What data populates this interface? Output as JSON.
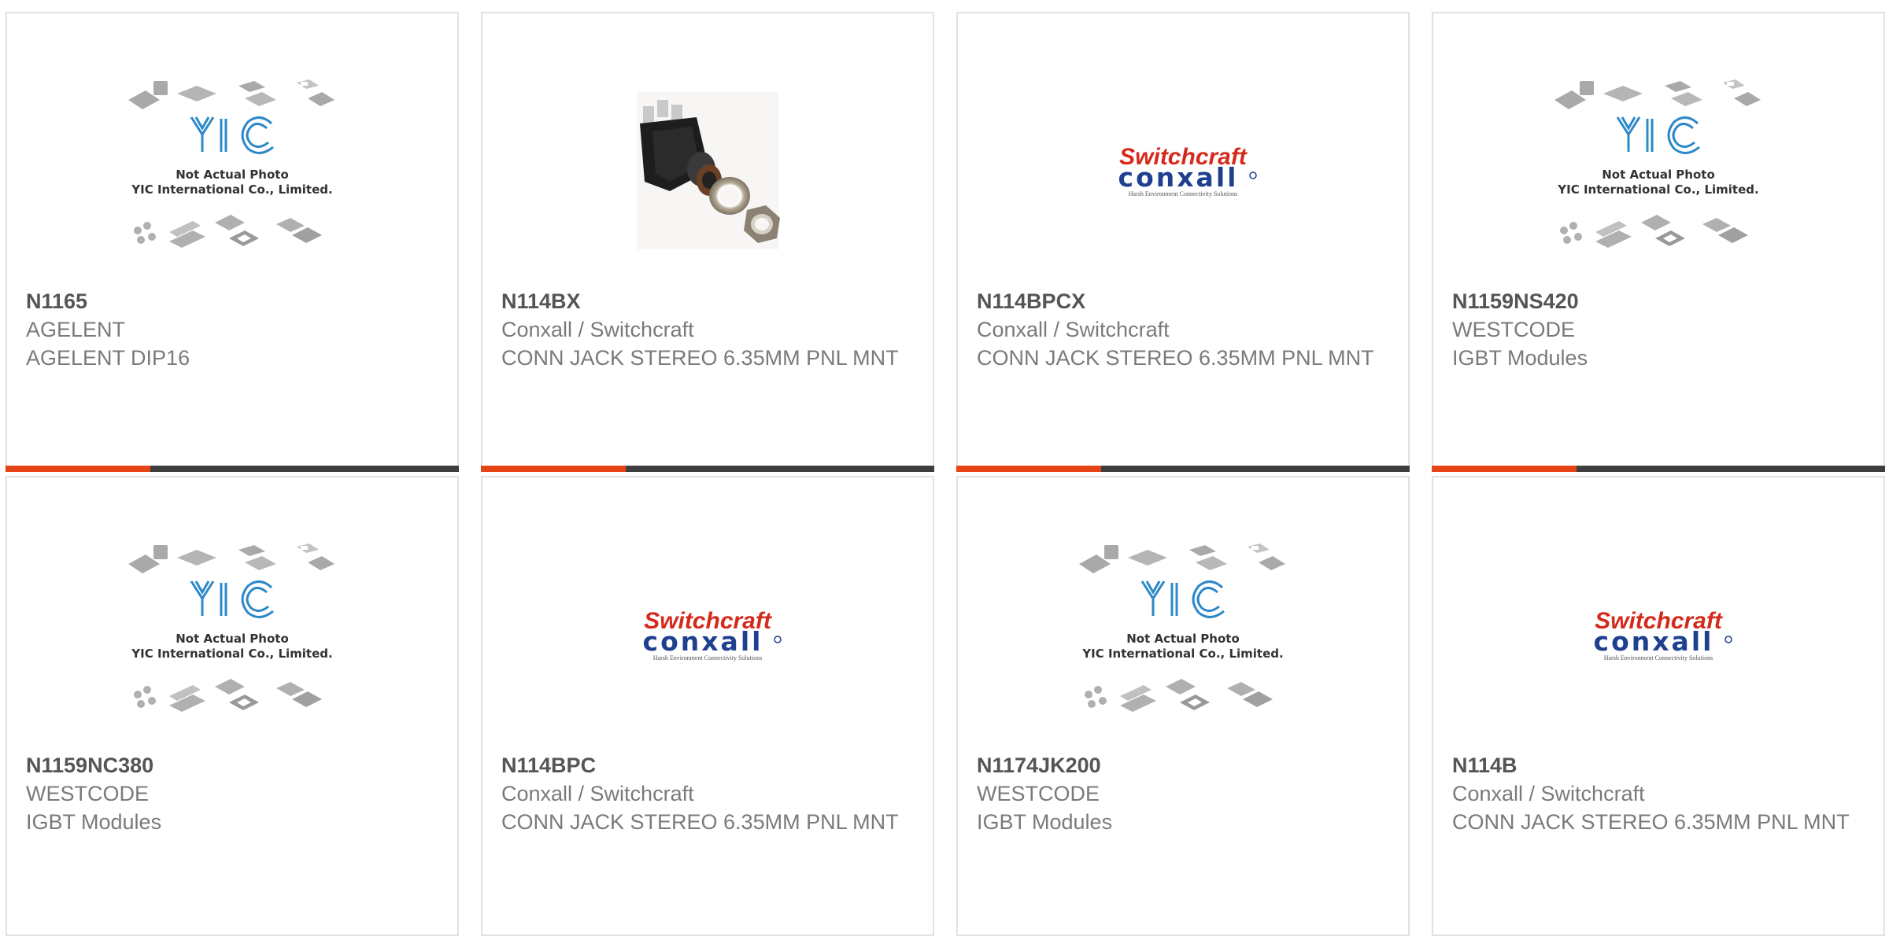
{
  "colors": {
    "accent": "#e64316",
    "bar": "#3e3e3e",
    "yic_blue": "#2c88c8",
    "switchcraft_red": "#d42a1c",
    "conxall_blue": "#1f3f8f"
  },
  "products": [
    {
      "part": "N1165",
      "maker": "AGELENT",
      "desc": "AGELENT DIP16",
      "image": "yic-placeholder",
      "placeholder": {
        "line1": "Not Actual Photo",
        "line2": "YIC International Co., Limited."
      }
    },
    {
      "part": "N114BX",
      "maker": "Conxall / Switchcraft",
      "desc": "CONN JACK STEREO 6.35MM PNL MNT",
      "image": "jack-photo"
    },
    {
      "part": "N114BPCX",
      "maker": "Conxall / Switchcraft",
      "desc": "CONN JACK STEREO 6.35MM PNL MNT",
      "image": "switchcraft-logo",
      "logo": {
        "top": "Switchcraft",
        "bottom": "conxall",
        "tagline": "Harsh Environment Connectivity Solutions"
      }
    },
    {
      "part": "N1159NS420",
      "maker": "WESTCODE",
      "desc": "IGBT Modules",
      "image": "yic-placeholder",
      "placeholder": {
        "line1": "Not Actual Photo",
        "line2": "YIC International Co., Limited."
      }
    },
    {
      "part": "N1159NC380",
      "maker": "WESTCODE",
      "desc": "IGBT Modules",
      "image": "yic-placeholder",
      "placeholder": {
        "line1": "Not Actual Photo",
        "line2": "YIC International Co., Limited."
      }
    },
    {
      "part": "N114BPC",
      "maker": "Conxall / Switchcraft",
      "desc": "CONN JACK STEREO 6.35MM PNL MNT",
      "image": "switchcraft-logo",
      "logo": {
        "top": "Switchcraft",
        "bottom": "conxall",
        "tagline": "Harsh Environment Connectivity Solutions"
      }
    },
    {
      "part": "N1174JK200",
      "maker": "WESTCODE",
      "desc": "IGBT Modules",
      "image": "yic-placeholder",
      "placeholder": {
        "line1": "Not Actual Photo",
        "line2": "YIC International Co., Limited."
      }
    },
    {
      "part": "N114B",
      "maker": "Conxall / Switchcraft",
      "desc": "CONN JACK STEREO 6.35MM PNL MNT",
      "image": "switchcraft-logo",
      "logo": {
        "top": "Switchcraft",
        "bottom": "conxall",
        "tagline": "Harsh Environment Connectivity Solutions"
      }
    }
  ]
}
